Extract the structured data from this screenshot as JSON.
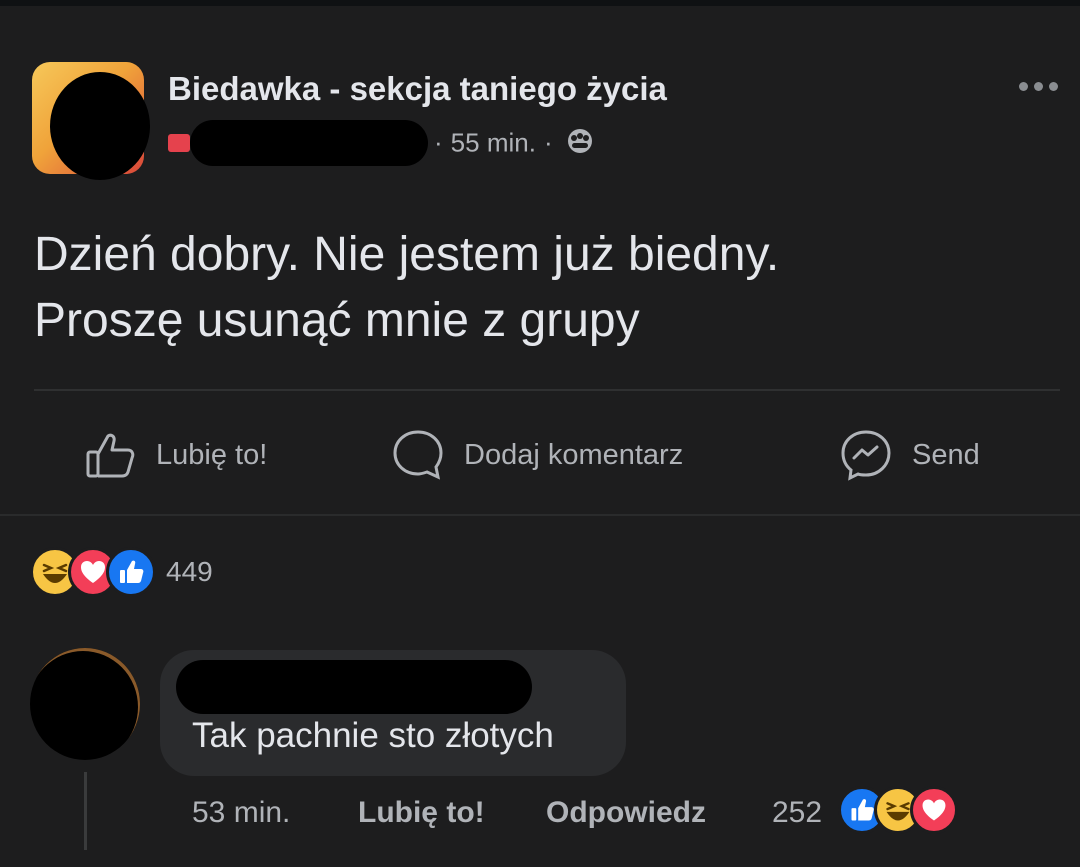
{
  "post": {
    "group_name": "Biedawka - sekcja taniego życia",
    "time": "55 min.",
    "meta_separator": "·",
    "text_line1": "Dzień dobry. Nie jestem już biedny.",
    "text_line2": "Proszę usunąć mnie z grupy"
  },
  "actions": {
    "like_label": "Lubię to!",
    "comment_label": "Dodaj komentarz",
    "send_label": "Send"
  },
  "reactions": {
    "count": "449",
    "icons": [
      "haha-icon",
      "love-icon",
      "like-icon"
    ]
  },
  "comment": {
    "text": "Tak pachnie sto złotych",
    "time": "53 min.",
    "like_label": "Lubię to!",
    "reply_label": "Odpowiedz",
    "reaction_count": "252",
    "reaction_icons": [
      "like-icon",
      "haha-icon",
      "love-icon"
    ]
  },
  "colors": {
    "background": "#1d1d1e",
    "text_primary": "#e4e6eb",
    "text_secondary": "#b0b3b8",
    "like_blue": "#1877f2",
    "love_red": "#f33e58",
    "haha_yellow": "#f7c544"
  }
}
